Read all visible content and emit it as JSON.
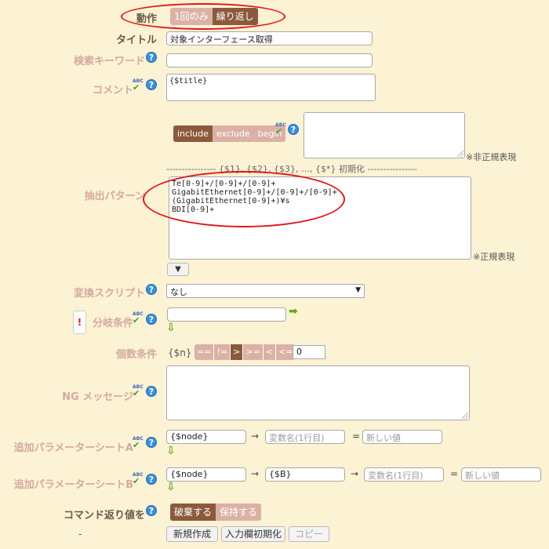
{
  "action": {
    "label": "動作",
    "options": [
      "1回のみ",
      "繰り返し"
    ],
    "selected": 1
  },
  "title": {
    "label": "タイトル",
    "value": "対象インターフェース取得"
  },
  "search_keyword": {
    "label": "検索キーワード",
    "value": ""
  },
  "comment": {
    "label": "コメント",
    "value": "{$title}"
  },
  "filter": {
    "modes": [
      "include",
      "exclude",
      "begin"
    ],
    "selected": 0,
    "value": "",
    "note": "※非正規表現"
  },
  "init_line": "---------------- {$1}, {$2}, {$3}, …, {$*} 初期化 ----------------",
  "extract": {
    "label": "抽出パターン",
    "value": "Te[0-9]+/[0-9]+/[0-9]+\nGigabitEthernet[0-9]+/[0-9]+/[0-9]+\n(GigabitEthernet[0-9]+)¥s\nBDI[0-9]+",
    "note": "※正規表現",
    "toggle_icon": "▼"
  },
  "script": {
    "label": "変換スクリプト",
    "selected": "なし"
  },
  "branch": {
    "label": "分岐条件",
    "badge": "!",
    "value": ""
  },
  "count": {
    "label": "個数条件",
    "var": "{$n}",
    "ops": [
      "==",
      "!=",
      ">",
      ">=",
      "<",
      "<="
    ],
    "selected": 2,
    "value": "0"
  },
  "ng": {
    "label": "NG メッセージ",
    "value": ""
  },
  "param_a": {
    "label": "追加パラメーターシートA",
    "key": "{$node}",
    "var_placeholder": "変数名(1行目)",
    "new_placeholder": "新しい値",
    "arrow": "→",
    "eq": "="
  },
  "param_b": {
    "label": "追加パラメーターシートB",
    "key": "{$node}",
    "key2": "{$B}",
    "var_placeholder": "変数名(1行目)",
    "new_placeholder": "新しい値",
    "arrow": "→",
    "eq": "="
  },
  "return_value": {
    "label": "コマンド返り値を",
    "options": [
      "破棄する",
      "保持する"
    ],
    "selected": 0
  },
  "footer": {
    "dash": "-",
    "buttons": [
      "新規作成",
      "入力欄初期化",
      "コピー"
    ]
  },
  "icons": {
    "help": "?",
    "spell_text": "ABC",
    "spell_check": "✔",
    "green_arrow_right": "➡",
    "green_arrow_down": "⇩"
  },
  "colors": {
    "accent": "#8b5a3c",
    "inactive": "#dbb1a6",
    "annotation": "#e0151b",
    "background": "#fcf2d4"
  }
}
